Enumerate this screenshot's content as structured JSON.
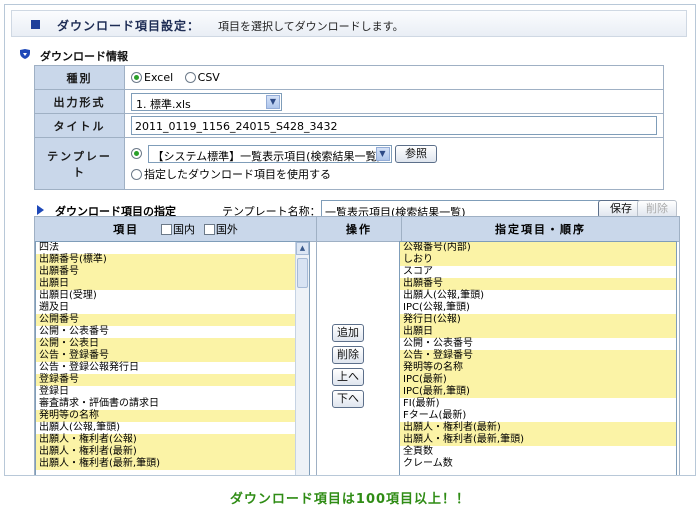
{
  "header": {
    "title": "ダウンロード項目設定：",
    "subtitle": "項目を選択してダウンロードします。"
  },
  "info_section": {
    "title": "ダウンロード情報",
    "rows": {
      "type_label": "種別",
      "type_options": [
        "Excel",
        "CSV"
      ],
      "format_label": "出力形式",
      "format_value": "1. 標準.xls",
      "title_label": "タイトル",
      "title_value": "2011_0119_1156_24015_S428_3432",
      "template_label": "テンプレート",
      "template_value": "【システム標準】一覧表示項目(検索結果一覧)",
      "browse_button": "参照",
      "use_template_option": "指定したダウンロード項目を使用する"
    }
  },
  "selection_section": {
    "title": "ダウンロード項目の指定",
    "template_name_label": "テンプレート名称：",
    "template_name_value": "一覧表示項目(検索結果一覧)",
    "save_button": "保存",
    "delete_button": "削除",
    "columns": {
      "items": "項目",
      "domestic": "国内",
      "foreign": "国外",
      "operation": "操作",
      "selected": "指定項目・順序"
    },
    "operations": [
      "追加",
      "削除",
      "上へ",
      "下へ"
    ],
    "available_items": [
      {
        "label": "四法",
        "hl": false
      },
      {
        "label": "出願番号(標準)",
        "hl": true
      },
      {
        "label": "出願番号",
        "hl": true
      },
      {
        "label": "出願日",
        "hl": true
      },
      {
        "label": "出願日(受理)",
        "hl": false
      },
      {
        "label": "遡及日",
        "hl": false
      },
      {
        "label": "公開番号",
        "hl": true
      },
      {
        "label": "公開・公表番号",
        "hl": false
      },
      {
        "label": "公開・公表日",
        "hl": true
      },
      {
        "label": "公告・登録番号",
        "hl": true
      },
      {
        "label": "公告・登録公報発行日",
        "hl": false
      },
      {
        "label": "登録番号",
        "hl": true
      },
      {
        "label": "登録日",
        "hl": false
      },
      {
        "label": "審査請求・評価書の請求日",
        "hl": false
      },
      {
        "label": "発明等の名称",
        "hl": true
      },
      {
        "label": "出願人(公報,筆頭)",
        "hl": false
      },
      {
        "label": "出願人・権利者(公報)",
        "hl": true
      },
      {
        "label": "出願人・権利者(最新)",
        "hl": true
      },
      {
        "label": "出願人・権利者(最新,筆頭)",
        "hl": true
      }
    ],
    "selected_items": [
      {
        "label": "公報番号(内部)",
        "hl": true
      },
      {
        "label": "しおり",
        "hl": true
      },
      {
        "label": "スコア",
        "hl": false
      },
      {
        "label": "出願番号",
        "hl": true
      },
      {
        "label": "出願人(公報,筆頭)",
        "hl": false
      },
      {
        "label": "IPC(公報,筆頭)",
        "hl": false
      },
      {
        "label": "発行日(公報)",
        "hl": true
      },
      {
        "label": "出願日",
        "hl": true
      },
      {
        "label": "公開・公表番号",
        "hl": false
      },
      {
        "label": "公告・登録番号",
        "hl": true
      },
      {
        "label": "発明等の名称",
        "hl": true
      },
      {
        "label": "IPC(最新)",
        "hl": true
      },
      {
        "label": "IPC(最新,筆頭)",
        "hl": true
      },
      {
        "label": "FI(最新)",
        "hl": false
      },
      {
        "label": "Fターム(最新)",
        "hl": false
      },
      {
        "label": "出願人・権利者(最新)",
        "hl": true
      },
      {
        "label": "出願人・権利者(最新,筆頭)",
        "hl": true
      },
      {
        "label": "全頁数",
        "hl": false
      },
      {
        "label": "クレーム数",
        "hl": false
      }
    ]
  },
  "caption": "ダウンロード項目は100項目以上！！",
  "colors": {
    "accent": "#1e3f9a",
    "header_cell": "#c9d7ea",
    "highlight_row": "#fbf3a6",
    "caption": "#2f8c15"
  }
}
